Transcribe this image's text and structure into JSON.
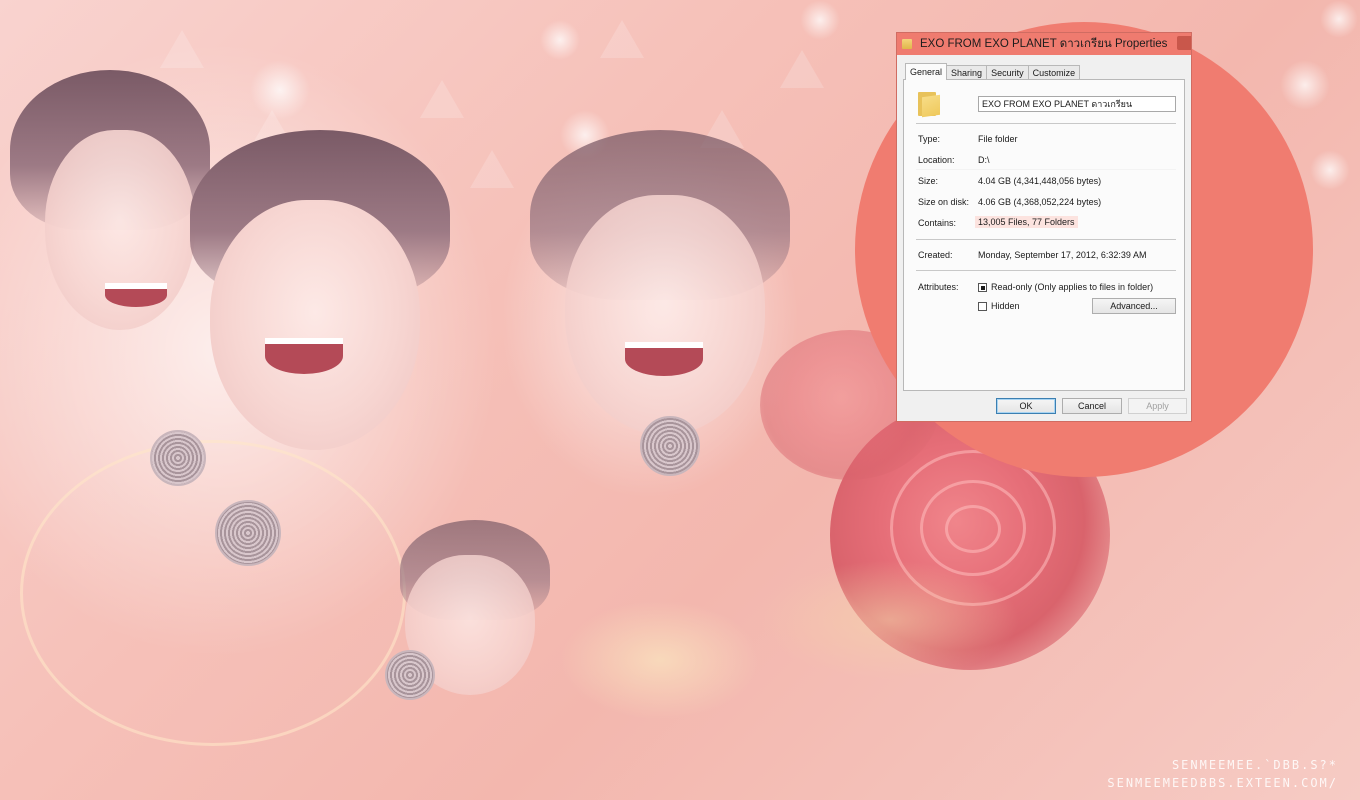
{
  "dialog": {
    "title": "EXO FROM EXO PLANET ดาวเกรียน Properties",
    "tabs": [
      {
        "label": "General",
        "active": true
      },
      {
        "label": "Sharing",
        "active": false
      },
      {
        "label": "Security",
        "active": false
      },
      {
        "label": "Customize",
        "active": false
      }
    ],
    "folder_name": "EXO FROM EXO PLANET ดาวเกรียน",
    "properties": {
      "type": {
        "label": "Type:",
        "value": "File folder"
      },
      "location": {
        "label": "Location:",
        "value": "D:\\"
      },
      "size": {
        "label": "Size:",
        "value": "4.04 GB (4,341,448,056 bytes)"
      },
      "size_on_disk": {
        "label": "Size on disk:",
        "value": "4.06 GB (4,368,052,224 bytes)"
      },
      "contains": {
        "label": "Contains:",
        "value": "13,005 Files, 77 Folders"
      },
      "created": {
        "label": "Created:",
        "value": "Monday, September 17, 2012, 6:32:39 AM"
      }
    },
    "attributes": {
      "label": "Attributes:",
      "readonly": {
        "label": "Read-only (Only applies to files in folder)",
        "checked": true
      },
      "hidden": {
        "label": "Hidden",
        "checked": false
      },
      "advanced_label": "Advanced..."
    },
    "buttons": {
      "ok": "OK",
      "cancel": "Cancel",
      "apply": "Apply"
    }
  },
  "watermark": {
    "line1": "SENMEEMEE.`DBB.S?*",
    "line2": "SENMEEMEEDBBS.EXTEEN.COM/"
  },
  "colors": {
    "titlebar": "#ef7b6f",
    "circle": "#f07c70",
    "background": "#f6c1b9"
  }
}
